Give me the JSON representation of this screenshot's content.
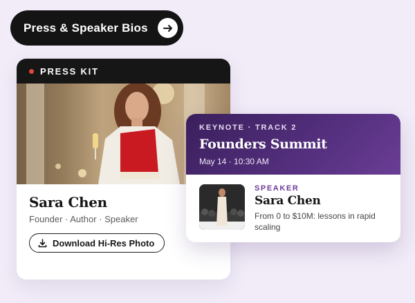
{
  "cta": {
    "label": "Press & Speaker Bios",
    "icon": "arrow-right-icon"
  },
  "press_kit": {
    "header_label": "PRESS KIT",
    "status_dot_color": "#e0483a",
    "photo": "portrait-photo",
    "name": "Sara Chen",
    "roles": "Founder · Author · Speaker",
    "download_label": "Download Hi-Res Photo",
    "download_icon": "download-icon"
  },
  "keynote": {
    "track": "KEYNOTE · TRACK 2",
    "event": "Founders Summit",
    "when": "May 14 · 10:30 AM",
    "speaker_tag": "SPEAKER",
    "speaker_name": "Sara Chen",
    "talk_title": "From 0 to $10M: lessons in rapid scaling",
    "accent_color": "#55307f"
  }
}
